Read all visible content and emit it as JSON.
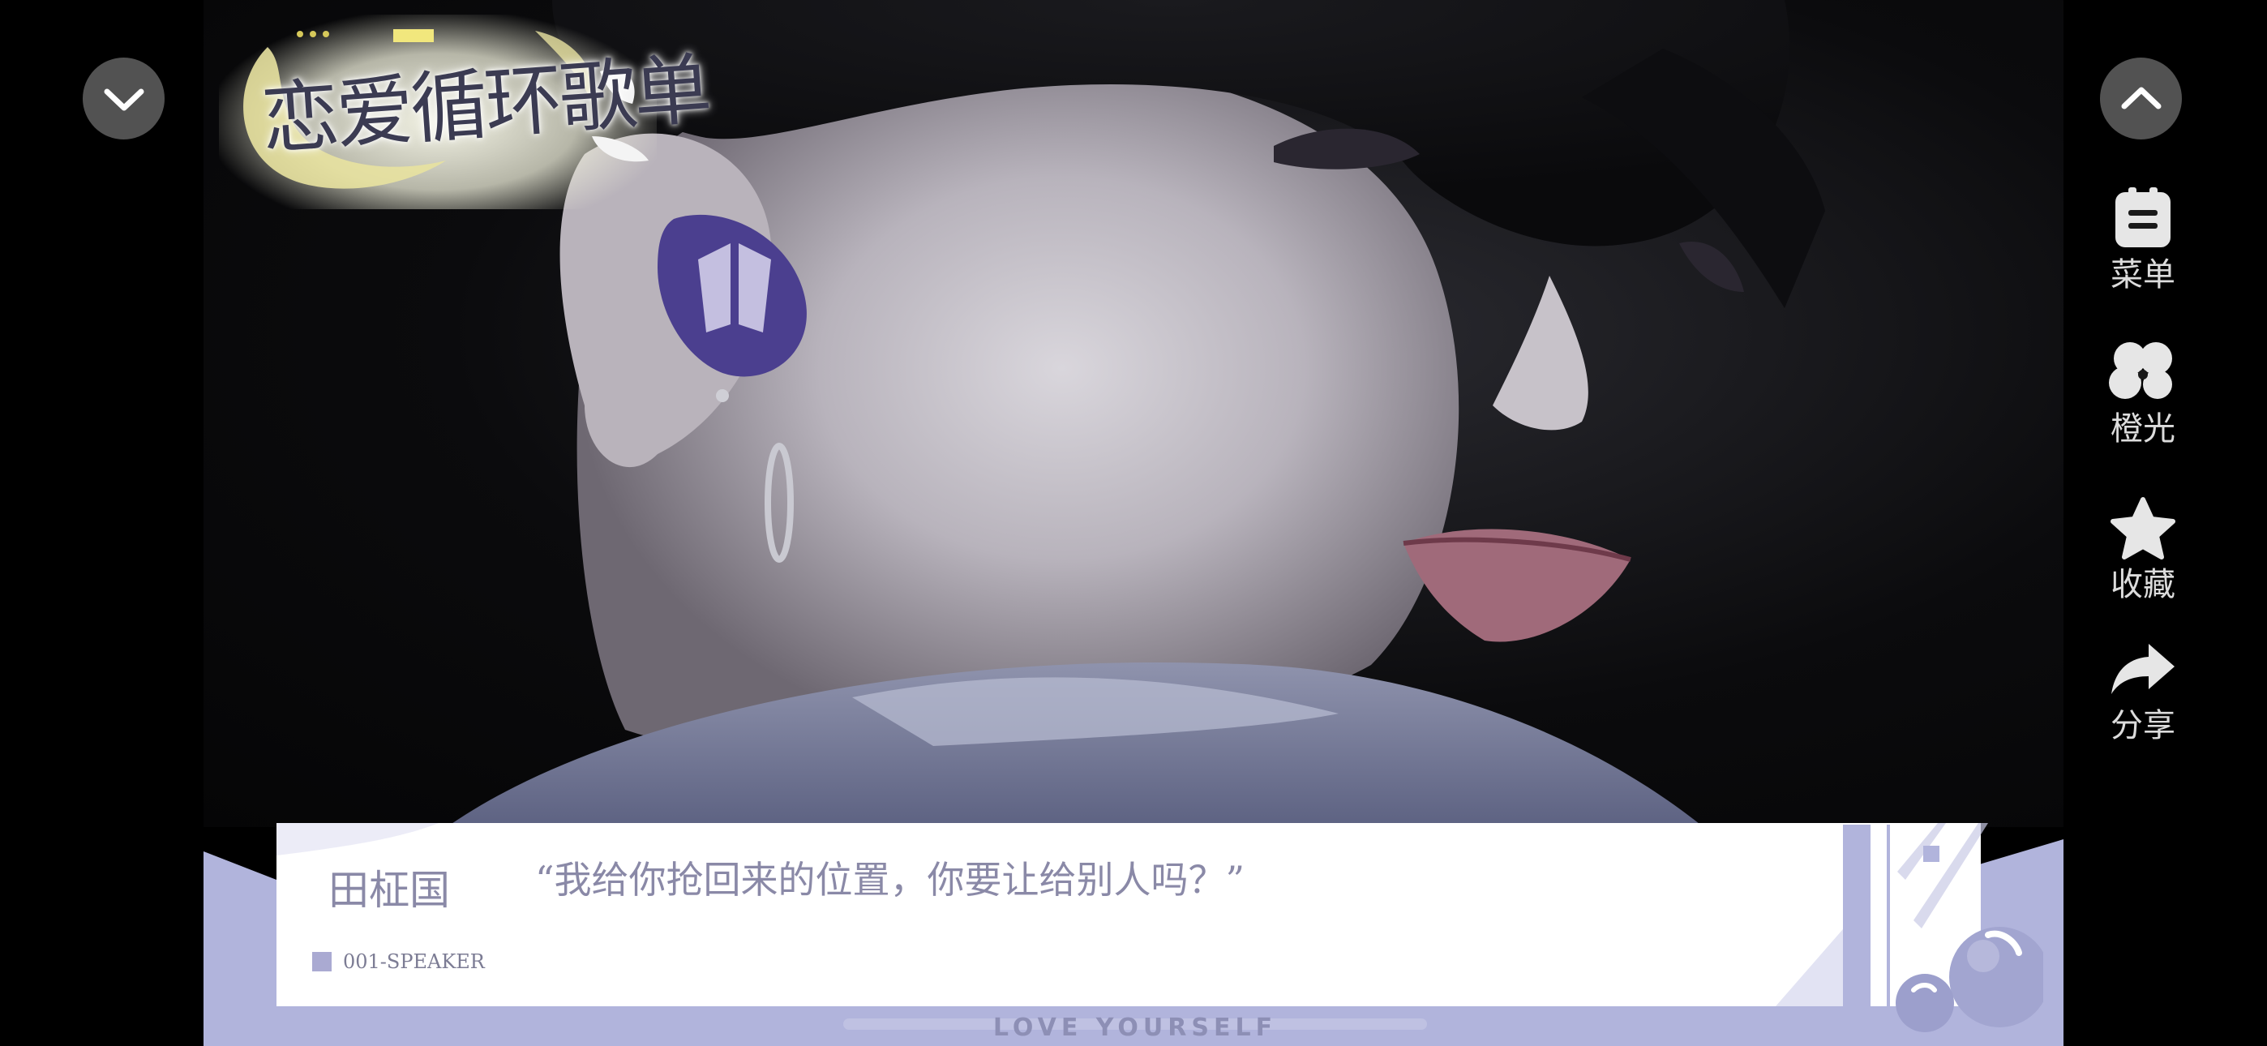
{
  "scene": {
    "description_icon": "character-cg-image"
  },
  "title_badge": {
    "text": "恋爱循环歌单"
  },
  "controls": {
    "collapse_icon": "chevron-down-icon",
    "expand_icon": "chevron-up-icon"
  },
  "side_menu": {
    "items": [
      {
        "label": "菜单",
        "icon": "menu-icon"
      },
      {
        "label": "橙光",
        "icon": "orange-light-icon"
      },
      {
        "label": "收藏",
        "icon": "star-icon"
      },
      {
        "label": "分享",
        "icon": "share-icon"
      }
    ]
  },
  "dialog": {
    "speaker": "田柾国",
    "speaker_tag": "001-SPEAKER",
    "line": "“我给你抢回来的位置，你要让给别人吗？”"
  },
  "footer": {
    "tagline": "LOVE YOURSELF"
  },
  "colors": {
    "dialog_band": "#b1b4dc",
    "dialog_text": "#8a89a7",
    "button_bg": "#969696"
  }
}
